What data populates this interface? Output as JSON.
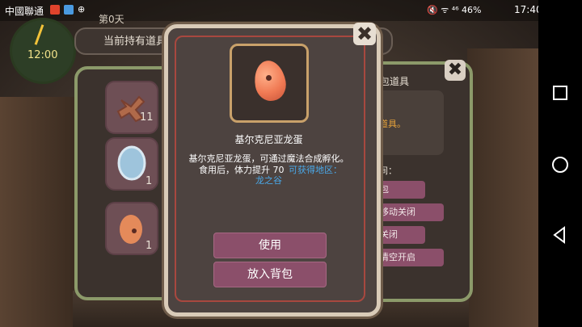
{
  "status_bar": {
    "carrier": "中國聯通",
    "app_icon_3": "⊕",
    "right_indicators": "🔇 ᯤ ⁴⁶ 46%",
    "time": "17:40"
  },
  "hud": {
    "clock_time": "12:00",
    "day_label": "第0天",
    "holding_label": "当前持有道具"
  },
  "left_panel": {
    "slots": [
      {
        "icon": "cookie-icon",
        "count": "11"
      },
      {
        "icon": "blue-stone-icon",
        "count": "1"
      },
      {
        "icon": "egg-icon",
        "count": "1"
      }
    ]
  },
  "right_panel": {
    "title": "背包道具",
    "hint": "有道具。",
    "space_label": "空间：",
    "buttons": [
      "背包",
      "即移动关闭",
      "用关闭",
      "动清空开启"
    ]
  },
  "dialog": {
    "item_name": "基尔克尼亚龙蛋",
    "desc_line1": "基尔克尼亚龙蛋，可通过魔法合成孵化。",
    "desc_line2": "食用后，体力提升 70",
    "link_text1": "可获得地区：",
    "link_text2": "龙之谷",
    "use_label": "使用",
    "put_label": "放入背包",
    "close_symbol": "✖"
  },
  "colors": {
    "accent_button": "#8b4f6a",
    "link": "#4aa8e8",
    "panel_border": "#8c9a6a"
  }
}
